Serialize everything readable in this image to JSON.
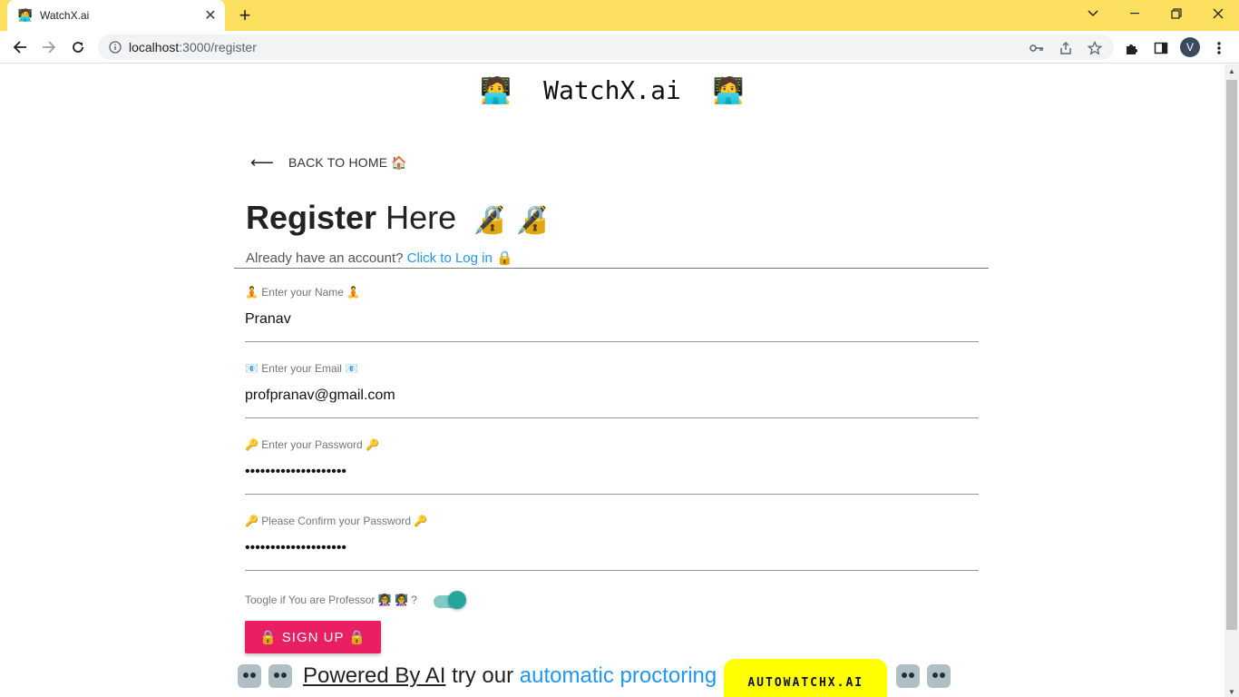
{
  "browser": {
    "tab_title": "WatchX.ai",
    "url_host": "localhost",
    "url_path": ":3000/register",
    "profile_initial": "V"
  },
  "page": {
    "brand": "WatchX.ai",
    "back_label": "BACK TO HOME 🏠",
    "heading_bold": "Register",
    "heading_rest": "Here",
    "heading_emoji": "🔏 🔏",
    "login_prompt": "Already have an account?",
    "login_link": "Click to Log in",
    "login_emoji": "🔒",
    "fields": [
      {
        "label": "🧘 Enter your Name 🧘",
        "value": "Pranav",
        "type": "text"
      },
      {
        "label": "📧 Enter your Email 📧",
        "value": "profpranav@gmail.com",
        "type": "email"
      },
      {
        "label": "🔑 Enter your Password 🔑",
        "value": "••••••••••••••••••••",
        "type": "password"
      },
      {
        "label": "🔑 Please Confirm your Password 🔑",
        "value": "••••••••••••••••••••",
        "type": "password"
      }
    ],
    "toggle_label": "Toogle if You are Professor 👩‍🏫 👩‍🏫 ?",
    "toggle_on": true,
    "signup_label": "🔒 SIGN UP 🔒",
    "footer": {
      "powered": "Powered By AI",
      "middle": " try our ",
      "link": "automatic proctoring",
      "badge": "AUTOWATCHX.AI"
    }
  },
  "colors": {
    "tabstrip": "#fde05f",
    "accent_pink": "#e91e63",
    "link_blue": "#2196f3",
    "toggle_teal": "#26a69a",
    "badge_yellow": "#ffff00"
  }
}
